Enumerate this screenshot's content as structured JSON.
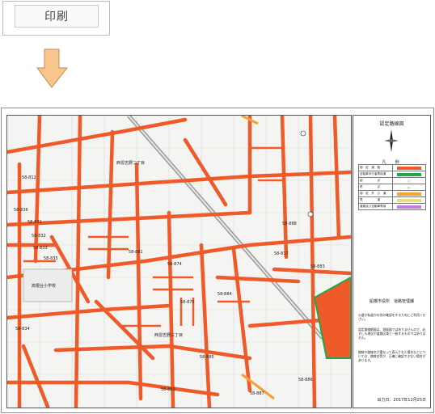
{
  "toolbar": {
    "print_label": "印刷"
  },
  "legend": {
    "title": "認定路線図",
    "heading": "凡　例",
    "rows": [
      {
        "label": "認　定　道　路",
        "color": "#f05a28",
        "symbol": ""
      },
      {
        "label": "自転車歩行者専用道",
        "color": "#1fa84a",
        "symbol": ""
      },
      {
        "label": "起　　　　　点",
        "color": "",
        "symbol": "○"
      },
      {
        "label": "終　　　　　点",
        "color": "",
        "symbol": "▷"
      },
      {
        "label": "認　定　外　公　道",
        "color": "#f3a233",
        "symbol": ""
      },
      {
        "label": "里　　　　　道",
        "color": "#e7e07a",
        "symbol": ""
      },
      {
        "label": "道路及び自動車専用",
        "color": "#c37be3",
        "symbol": ""
      }
    ],
    "office": "船橋市役所　道路管理課",
    "note1": "公道か私道かの別の確認をするためにご利用ください。",
    "note2": "認定路線網図は、測量図ではありませんので、必ずしも現況や道路区域と一致するものではありません。",
    "note3": "路線や路線名が重なって表示された場合などについては、路線名等が、正確に確認できない場合があります。",
    "date": "出力日：2017年12月25日"
  },
  "map": {
    "labels": {
      "area1": "西習志野二丁目",
      "area2": "西習志野三丁目",
      "school": "高根台小学校",
      "r1": "58-836",
      "r2": "58-831",
      "r3": "58-832",
      "r4": "58-833",
      "r5": "58-835",
      "r6": "58-834",
      "r7": "58-881",
      "r8": "58-874",
      "r9": "58-875",
      "r10": "58-884",
      "r11": "58-885",
      "r12": "58-886",
      "r13": "58-887",
      "r14": "58-888",
      "r15": "58-883",
      "r16": "58-889",
      "r17": "58-817",
      "r18": "58-812"
    }
  }
}
